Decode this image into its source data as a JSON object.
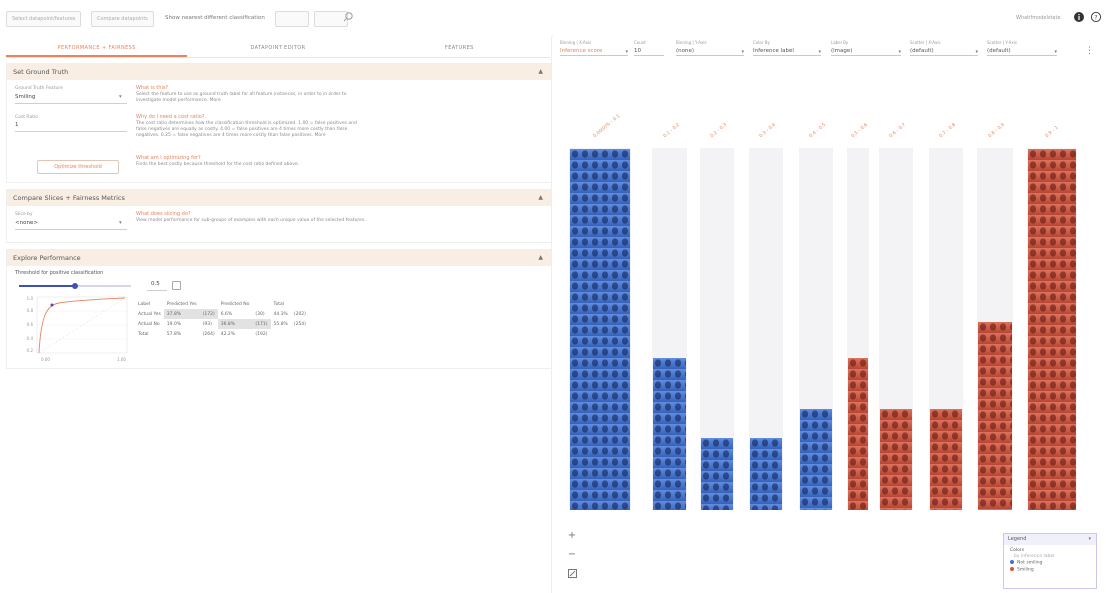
{
  "toolbar": {
    "btn1": "Select datapoint/features",
    "btn2": "Compare datapoints",
    "show_label": "Show nearest different classification",
    "btn3": "",
    "btn4": "",
    "right_text": "Whatifmodelstate",
    "icons": [
      "search-icon",
      "info-icon",
      "help-icon"
    ]
  },
  "tabs": [
    "PERFORMANCE + FAIRNESS",
    "DATAPOINT EDITOR",
    "FEATURES"
  ],
  "ground_truth": {
    "title": "Set Ground Truth",
    "feature_label": "Ground Truth Feature",
    "feature_value": "Smiling",
    "cost_label": "Cost Ratio",
    "cost_value": "1",
    "optimize_button": "Optimize threshold",
    "help1_title": "What is this?",
    "help1_text": "Select the feature to use as ground truth label for all feature instances, in order to in order to investigate model performance. More",
    "help2_title": "Why do I need a cost ratio?",
    "help2_text": "The cost ratio determines how the classification threshold is optimized. 1.00 = false positives and false negatives are equally as costly. 4.00 = false positives are 4 times more costly than false negatives. 0.25 = false negatives are 4 times more costly than false positives. More",
    "help3_title": "What am I optimizing for?",
    "help3_text": "Finds the best costly because threshold for the cost ratio defined above."
  },
  "fairness": {
    "title": "Compare Slices + Fairness Metrics",
    "slice_label": "Slice by",
    "slice_value": "<none>",
    "help_title": "What does slicing do?",
    "help_text": "View model performance for sub-groups of examples with each unique value of the selected features."
  },
  "performance": {
    "title": "Explore Performance",
    "threshold_label": "Threshold for positive classification",
    "threshold_value": "0.5",
    "threshold_fraction": 0.5,
    "plot_yticks": [
      "1.0",
      "0.8",
      "0.6",
      "0.4",
      "0.2"
    ],
    "plot_xticks": [
      "0.00",
      "1.00"
    ],
    "table_headers": [
      "Label",
      "Predicted Yes",
      "",
      "Predicted No",
      "",
      "Total",
      ""
    ],
    "rows": [
      [
        "Actual Yes",
        "37.8%",
        "(172)",
        "6.6%",
        "(30)",
        "44.3%",
        "(202)"
      ],
      [
        "Actual No",
        "19.0%",
        "(93)",
        "36.8%",
        "(171)",
        "55.8%",
        "(254)"
      ],
      [
        "Total",
        "57.8%",
        "(264)",
        "42.2%",
        "(192)",
        "",
        ""
      ]
    ]
  },
  "controls": [
    {
      "label": "Binning | X-Axis",
      "value": "Inference score"
    },
    {
      "label": "Count",
      "value": "10"
    },
    {
      "label": "Binning | Y-Axis",
      "value": "(none)"
    },
    {
      "label": "Color By",
      "value": "Inference label"
    },
    {
      "label": "Label By",
      "value": "(image)"
    },
    {
      "label": "Scatter | X-Axis",
      "value": "(default)"
    },
    {
      "label": "Scatter | Y-Axis",
      "value": "(default)"
    }
  ],
  "bins": [
    "0.00(0)% – 0.1",
    "0.1 – 0.2",
    "0.2 – 0.3",
    "0.3 – 0.4",
    "0.4 – 0.5",
    "0.5 – 0.6",
    "0.6 – 0.7",
    "0.7 – 0.8",
    "0.8 – 0.9",
    "0.9 – 1"
  ],
  "bin_fills": [
    1.0,
    0.42,
    0.2,
    0.2,
    0.28,
    0.42,
    0.28,
    0.28,
    0.52,
    1.0
  ],
  "legend": {
    "title": "Legend",
    "section": "Colors",
    "subtitle": "by inference label",
    "items": [
      "Not smiling",
      "Smiling"
    ],
    "colors": [
      "#3f73d9",
      "#d6533c"
    ]
  },
  "colors": {
    "accent": "#e8835e",
    "blue": "#3f73d9",
    "red": "#d6533c"
  }
}
